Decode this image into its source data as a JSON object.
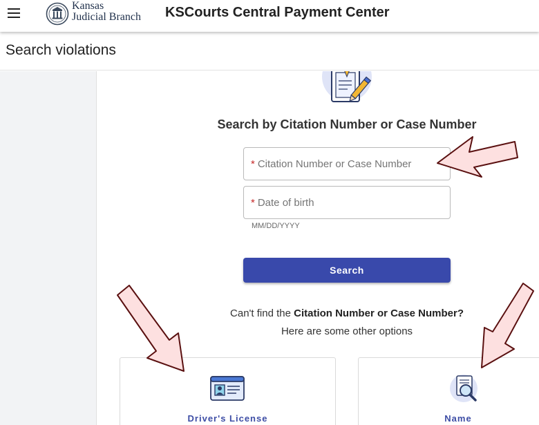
{
  "header": {
    "logo_line1": "Kansas",
    "logo_line2": "Judicial Branch",
    "app_title": "KSCourts Central Payment Center",
    "menu_icon": "hamburger-menu-icon"
  },
  "page": {
    "title": "Search violations"
  },
  "search": {
    "heading": "Search by Citation Number or Case Number",
    "citation_placeholder": "Citation Number or Case Number",
    "dob_placeholder": "Date of birth",
    "required_marker": "*",
    "dob_hint": "MM/DD/YYYY",
    "button_label": "Search"
  },
  "help": {
    "prefix": "Can't find the ",
    "bold": "Citation Number or Case Number?",
    "line2": "Here are some other options"
  },
  "options": [
    {
      "label": "Driver's License",
      "icon": "drivers-license-icon"
    },
    {
      "label": "Name",
      "icon": "name-search-icon"
    }
  ],
  "colors": {
    "primary": "#3949ab",
    "required": "#c62828",
    "arrow_fill": "#fde0e0",
    "arrow_stroke": "#5a1010"
  }
}
